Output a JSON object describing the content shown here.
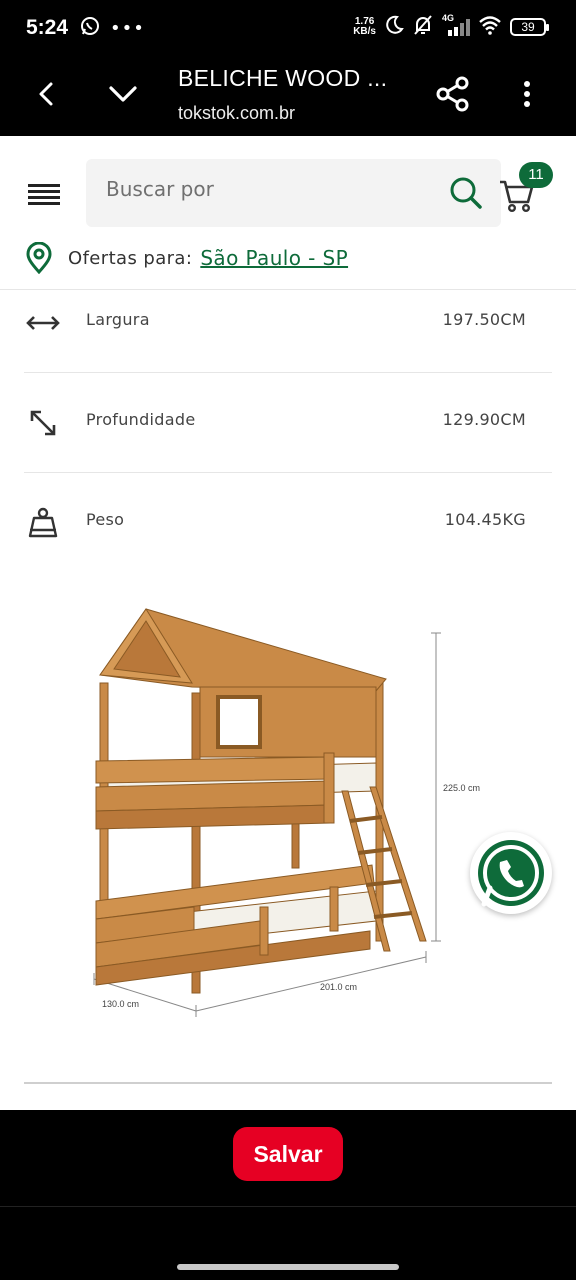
{
  "status_bar": {
    "time": "5:24",
    "netspeed_value": "1.76",
    "netspeed_unit": "KB/s",
    "network": "4G",
    "battery": "39"
  },
  "browser": {
    "title": "BELICHE WOOD ...",
    "domain": "tokstok.com.br"
  },
  "header": {
    "search_placeholder": "Buscar por",
    "cart_count": "11",
    "location_prefix": "Ofertas para:",
    "location_city": "São Paulo - SP",
    "accent_color": "#0e6b3a"
  },
  "specs": [
    {
      "label": "Largura",
      "value": "197.50CM",
      "icon": "horizontal-arrows-icon"
    },
    {
      "label": "Profundidade",
      "value": "129.90CM",
      "icon": "diagonal-arrows-icon"
    },
    {
      "label": "Peso",
      "value": "104.45KG",
      "icon": "weight-icon"
    }
  ],
  "product_image": {
    "dim_height": "225.0 cm",
    "dim_length": "201.0 cm",
    "dim_depth": "130.0 cm"
  },
  "bottom": {
    "save_label": "Salvar",
    "save_color": "#e60023"
  }
}
